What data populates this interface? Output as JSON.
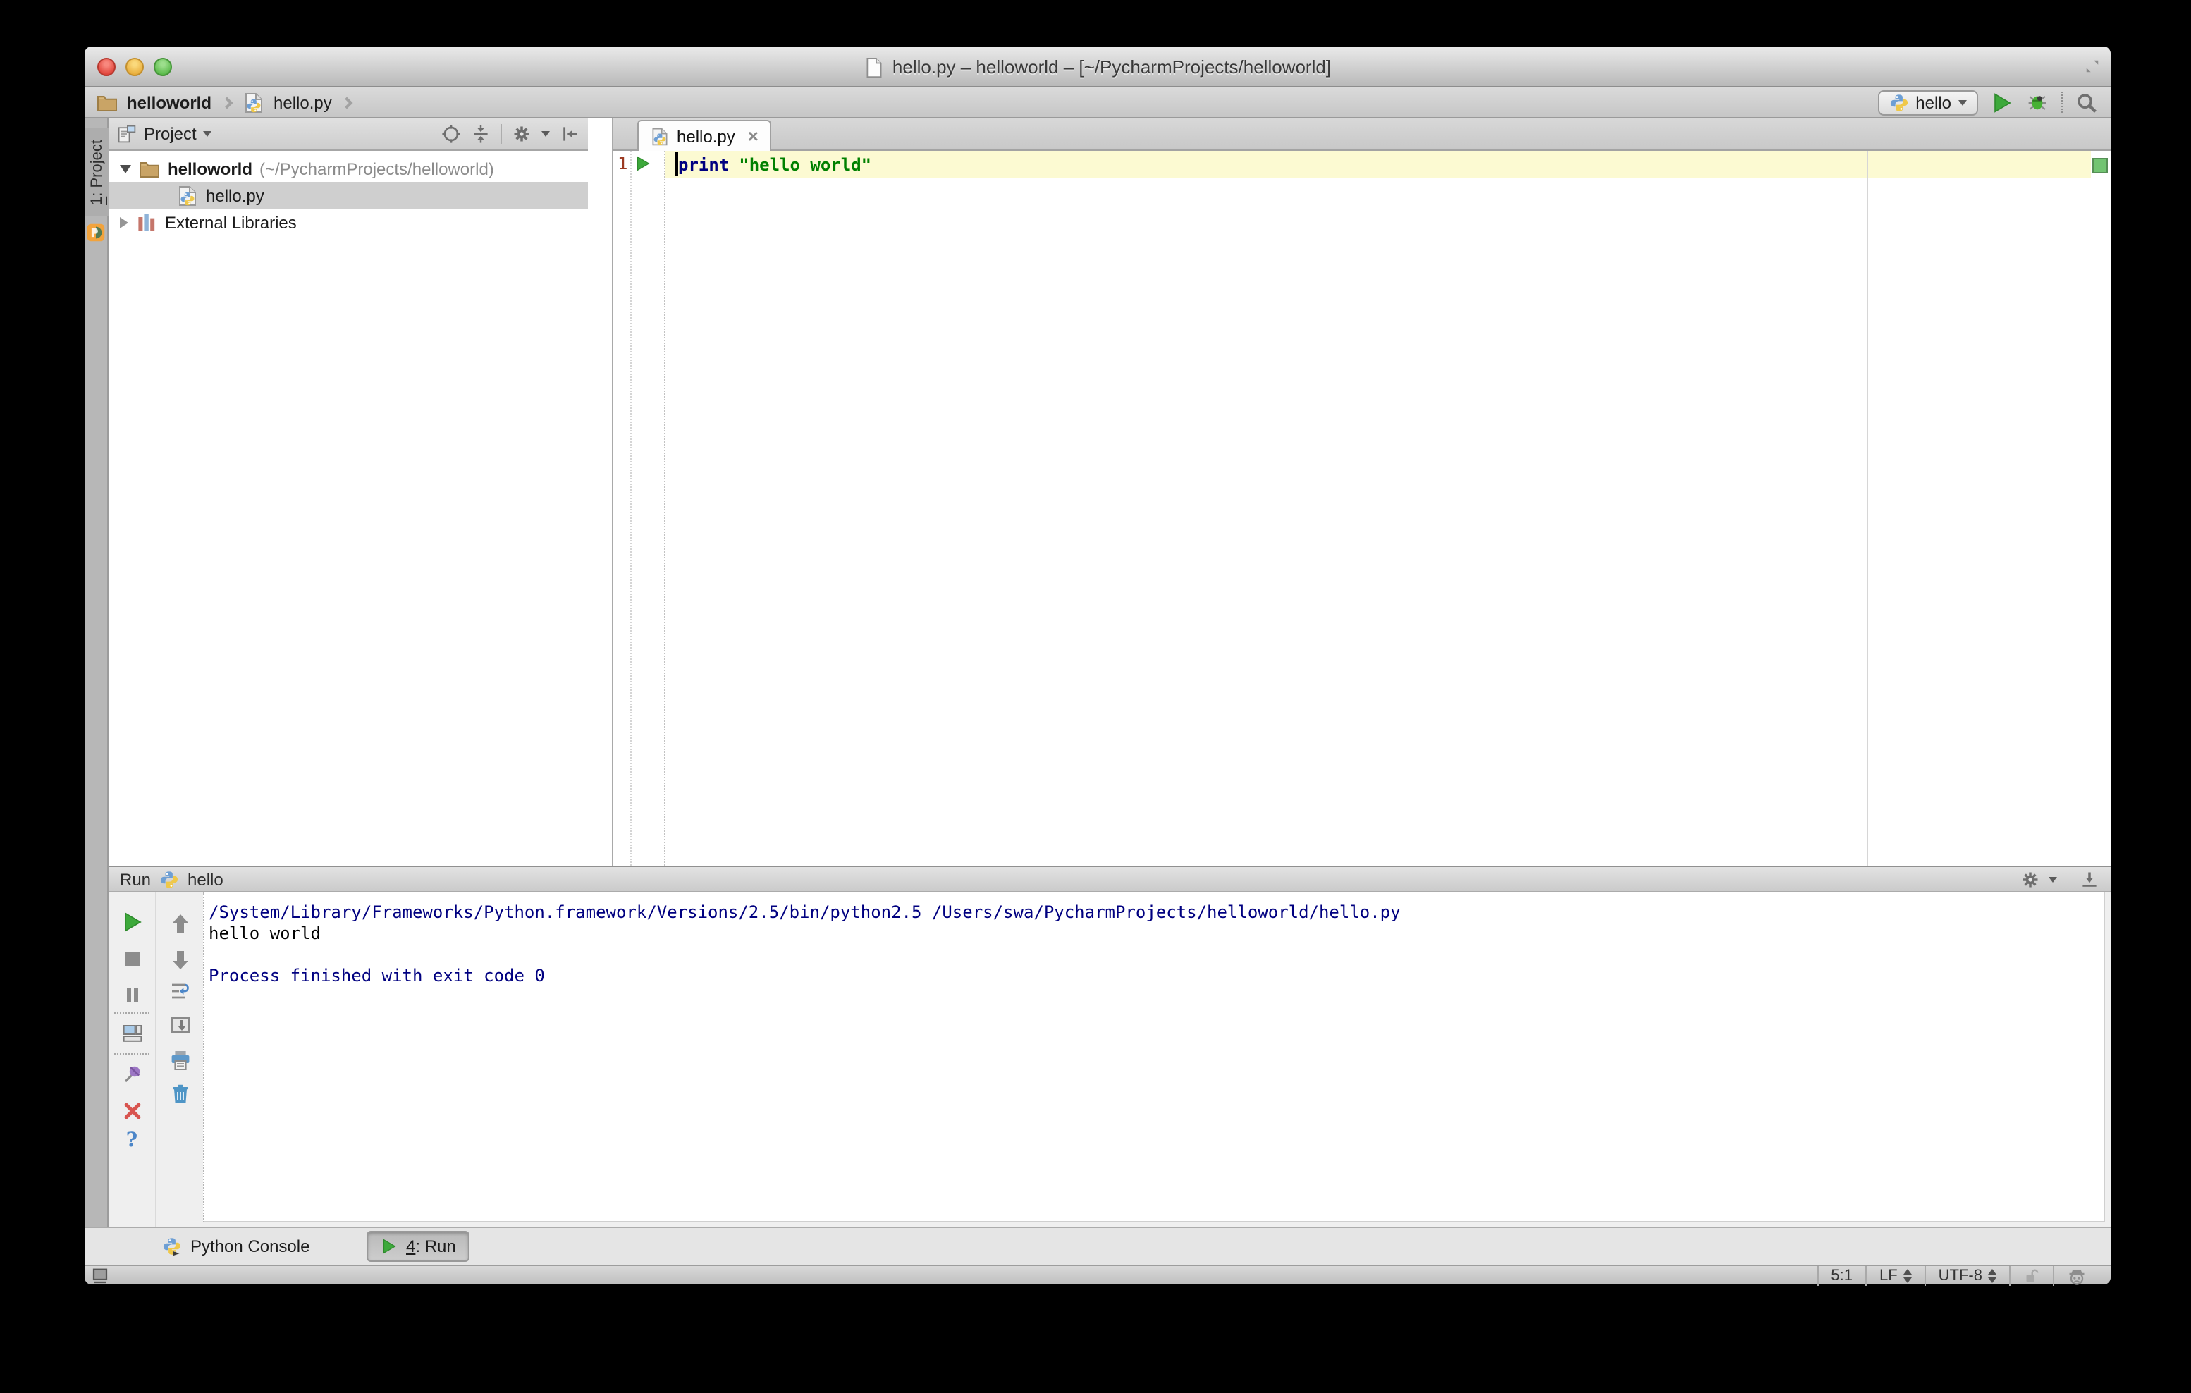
{
  "window": {
    "title": "hello.py – helloworld – [~/PycharmProjects/helloworld]",
    "traffic_lights": [
      "close",
      "minimize",
      "zoom"
    ]
  },
  "nav_bar": {
    "breadcrumbs": [
      {
        "label": "helloworld",
        "icon": "folder-icon"
      },
      {
        "label": "hello.py",
        "icon": "python-file-icon"
      }
    ],
    "run_config": {
      "label": "hello",
      "icon": "python-icon"
    },
    "right_icons": [
      "run-icon",
      "debug-icon",
      "search-icon"
    ]
  },
  "tool_stripe": {
    "project_tab_num": "1",
    "project_tab_rest": ": Project",
    "logo_icon": "pycharm-logo-icon"
  },
  "project_panel": {
    "title": "Project",
    "header_icons": [
      "locate-icon",
      "collapse-all-icon",
      "settings-gear-icon",
      "hide-panel-icon"
    ],
    "tree": [
      {
        "name": "helloworld",
        "path_suffix": "(~/PycharmProjects/helloworld)",
        "icon": "folder-icon",
        "state": "expanded"
      },
      {
        "name": "hello.py",
        "icon": "python-file-icon",
        "state": "selected"
      },
      {
        "name": "External Libraries",
        "icon": "libraries-icon",
        "state": "collapsed"
      }
    ]
  },
  "editor": {
    "tab_label": "hello.py",
    "close_glyph": "×",
    "line_number": "1",
    "code_keyword": "print",
    "code_string": "\"hello world\"",
    "colors": {
      "keyword": "#000080",
      "string": "#008000",
      "current_line_bg": "#FCFAD2",
      "line_number": "#9C3A21",
      "inspection_ok": "#72C472"
    }
  },
  "run_panel": {
    "title": "Run",
    "config_label": "hello",
    "header_icons": [
      "settings-gear-icon",
      "hide-down-icon"
    ],
    "left_toolbar_icons": [
      "rerun-icon",
      "stop-icon",
      "pause-output-icon",
      "restore-layout-icon",
      "pin-tab-icon",
      "close-icon",
      "help-icon"
    ],
    "console_toolbar_icons": [
      "up-stack-trace-icon",
      "down-stack-trace-icon",
      "soft-wrap-icon",
      "scroll-to-end-icon",
      "print-icon",
      "clear-all-icon"
    ],
    "console_lines": [
      "/System/Library/Frameworks/Python.framework/Versions/2.5/bin/python2.5 /Users/swa/PycharmProjects/helloworld/hello.py",
      "hello world",
      "",
      "Process finished with exit code 0"
    ],
    "console_line_colors": [
      "#000080",
      "#000000",
      "",
      "#000080"
    ]
  },
  "bottom_bar": {
    "python_console_label": "Python Console",
    "run_button_num": "4",
    "run_button_rest": ": Run"
  },
  "status_bar": {
    "caret_position": "5:1",
    "line_separator": "LF",
    "encoding": "UTF-8",
    "left_icons": [
      "toggle-toolwindow-bars-icon"
    ],
    "right_icons": [
      "unlock-icon",
      "inspections-profile-icon"
    ]
  }
}
